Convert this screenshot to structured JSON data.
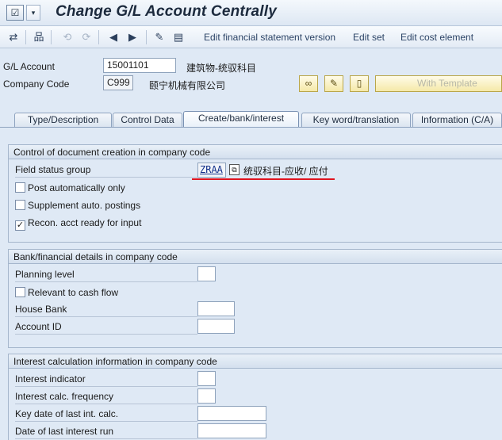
{
  "window": {
    "title": "Change G/L Account Centrally",
    "menu_icon": "☑",
    "menu_arrow": "▾"
  },
  "toolbar": {
    "links": [
      "Edit financial statement version",
      "Edit set",
      "Edit cost element"
    ]
  },
  "header": {
    "gl_account_label": "G/L Account",
    "gl_account_value": "15001101",
    "gl_account_desc": "建筑物-统驭科目",
    "company_code_label": "Company Code",
    "company_code_value": "C999",
    "company_code_desc": "颐宁机械有限公司",
    "with_template_label": "With Template"
  },
  "tabs": [
    {
      "label": "Type/Description",
      "active": false
    },
    {
      "label": "Control Data",
      "active": false
    },
    {
      "label": "Create/bank/interest",
      "active": true
    },
    {
      "label": "Key word/translation",
      "active": false
    },
    {
      "label": "Information (C/A)",
      "active": false
    }
  ],
  "groups": {
    "doc_creation": {
      "title": "Control of document creation in company code",
      "field_status_group_label": "Field status group",
      "field_status_group_value": "ZRAA",
      "field_status_group_desc": "统驭科目-应收/ 应付",
      "post_auto_label": "Post automatically only",
      "post_auto_checked": false,
      "supplement_label": "Supplement auto. postings",
      "supplement_checked": false,
      "recon_label": "Recon. acct ready for input",
      "recon_checked": true
    },
    "bank": {
      "title": "Bank/financial details in company code",
      "planning_level_label": "Planning level",
      "cash_flow_label": "Relevant to cash flow",
      "cash_flow_checked": false,
      "house_bank_label": "House Bank",
      "account_id_label": "Account ID"
    },
    "interest": {
      "title": "Interest calculation information in company code",
      "indicator_label": "Interest indicator",
      "frequency_label": "Interest calc. frequency",
      "key_date_label": "Key date of last int. calc.",
      "last_run_label": "Date of last interest run"
    }
  },
  "colors": {
    "accent_red": "#e0141e",
    "panel_bg": "#dfe9f5"
  }
}
